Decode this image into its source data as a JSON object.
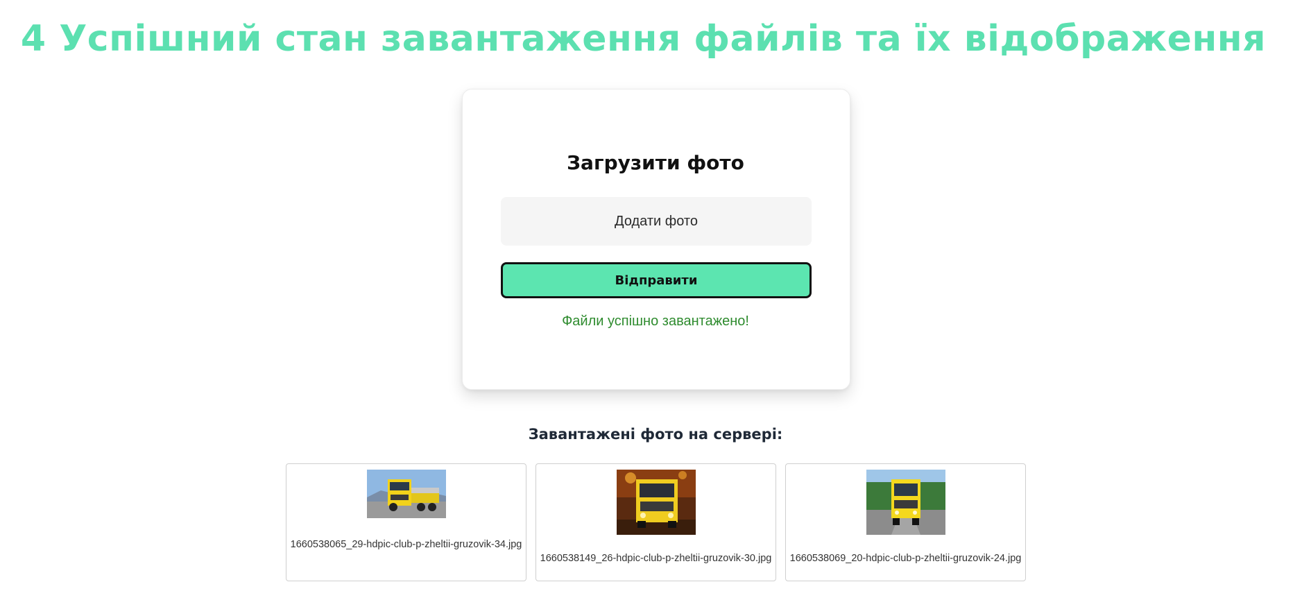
{
  "heading": "4 Успішний стан завантаження файлів та їх відображення",
  "upload": {
    "title": "Загрузити фото",
    "add_photo_label": "Додати фото",
    "send_label": "Відправити",
    "success_message": "Файли успішно завантажено!"
  },
  "gallery": {
    "title": "Завантажені фото на сервері:",
    "photos": [
      {
        "filename": "1660538065_29-hdpic-club-p-zheltii-gruzovik-34.jpg",
        "icon": "truck-photo"
      },
      {
        "filename": "1660538149_26-hdpic-club-p-zheltii-gruzovik-30.jpg",
        "icon": "truck-night-photo"
      },
      {
        "filename": "1660538069_20-hdpic-club-p-zheltii-gruzovik-24.jpg",
        "icon": "truck-road-photo"
      }
    ]
  },
  "colors": {
    "accent": "#5ce5b0",
    "heading": "#5ce0b0",
    "success": "#2e8b2e"
  }
}
